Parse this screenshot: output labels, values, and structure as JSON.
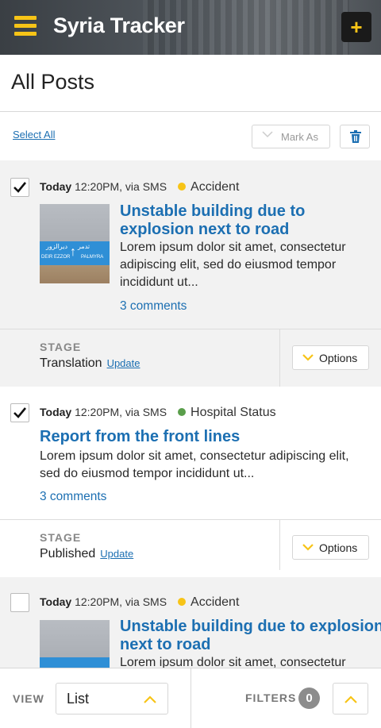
{
  "header": {
    "app_title": "Syria Tracker",
    "add_label": "+",
    "accent": "#f7c417"
  },
  "page": {
    "title": "All Posts"
  },
  "toolbar": {
    "select_all": "Select All",
    "mark_as": "Mark As"
  },
  "posts": [
    {
      "checked": true,
      "when": "Today",
      "time_source": " 12:20PM, via SMS",
      "category": "Accident",
      "category_color": "#f7c417",
      "title": "Unstable building due to explosion next to road",
      "body": "Lorem ipsum dolor sit amet, consectetur adipiscing elit, sed do eiusmod tempor incididunt ut...",
      "comments": "3 comments",
      "has_image": true,
      "image_text": {
        "arabic_1": "تدمر",
        "arabic_2": "ديرالزور",
        "latin_1": "DEIR EZZOR",
        "latin_2": "PALMYRA"
      },
      "stage_label": "STAGE",
      "stage_value": "Translation",
      "update_label": "Update",
      "options_label": "Options"
    },
    {
      "checked": true,
      "when": "Today",
      "time_source": " 12:20PM, via SMS",
      "category": "Hospital Status",
      "category_color": "#5a9e4b",
      "title": "Report from the front lines",
      "body": "Lorem ipsum dolor sit amet, consectetur adipiscing elit, sed do eiusmod tempor incididunt ut...",
      "comments": "3 comments",
      "has_image": false,
      "stage_label": "STAGE",
      "stage_value": "Published",
      "update_label": "Update",
      "options_label": "Options"
    },
    {
      "checked": false,
      "when": "Today",
      "time_source": " 12:20PM, via SMS",
      "category": "Accident",
      "category_color": "#f7c417",
      "title": "Unstable building due to explosion next to road",
      "body": "Lorem ipsum dolor sit amet, consectetur",
      "has_image": true
    }
  ],
  "bottom": {
    "view_label": "VIEW",
    "view_value": "List",
    "filters_label": "FILTERS",
    "filters_count": "0"
  }
}
